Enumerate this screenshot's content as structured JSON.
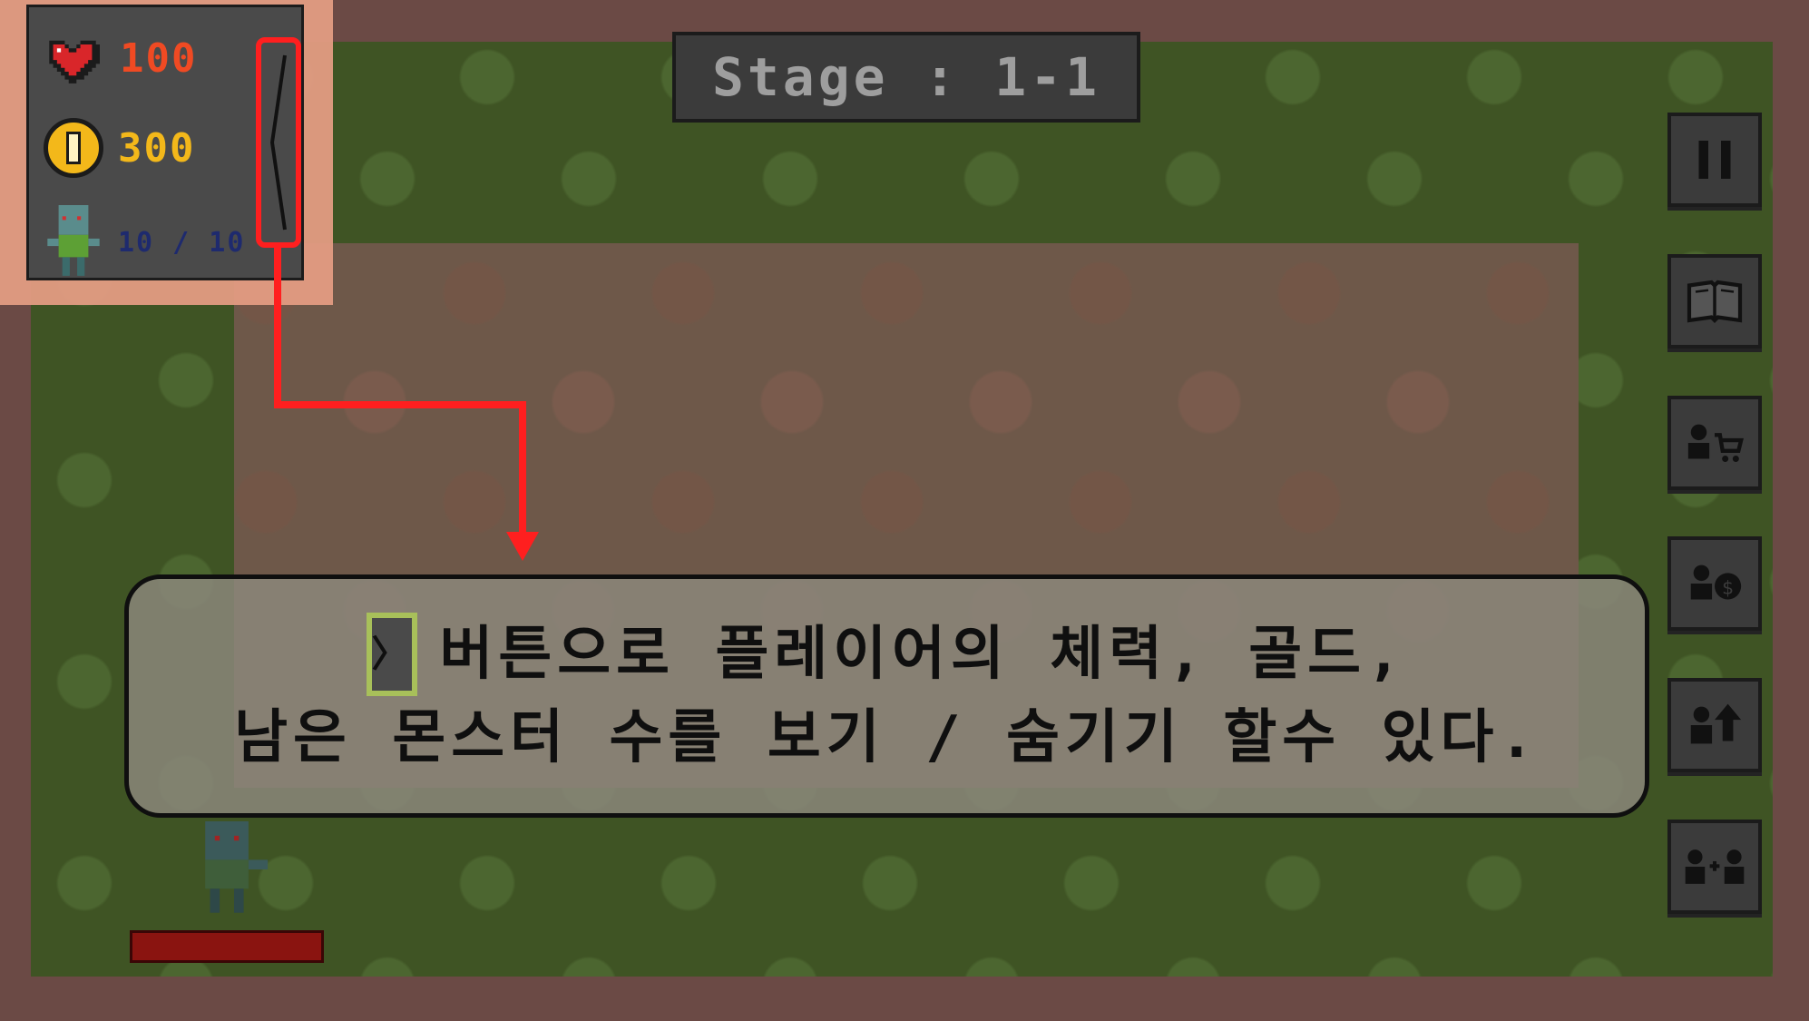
{
  "hud": {
    "hp": "100",
    "gold": "300",
    "monsters": "10 / 10",
    "toggle_symbol": "〈"
  },
  "stage": {
    "label": "Stage : 1-1"
  },
  "side_buttons": [
    {
      "name": "pause-button",
      "icon": "pause-icon"
    },
    {
      "name": "book-button",
      "icon": "book-icon"
    },
    {
      "name": "unit-shop-button",
      "icon": "person-cart-icon"
    },
    {
      "name": "unit-sell-button",
      "icon": "person-coin-icon"
    },
    {
      "name": "unit-upgrade-button",
      "icon": "person-up-arrow-icon"
    },
    {
      "name": "unit-merge-button",
      "icon": "person-plus-person-icon"
    }
  ],
  "tutorial": {
    "button_glyph": "〉",
    "line1": "버튼으로 플레이어의 체력, 골드,",
    "line2": "남은 몬스터 수를 보기 / 숨기기 할수 있다."
  },
  "colors": {
    "highlight": "#ff1f1f",
    "hp": "#f04a23",
    "gold": "#f3b81a",
    "monsters": "#1e2a6e"
  }
}
